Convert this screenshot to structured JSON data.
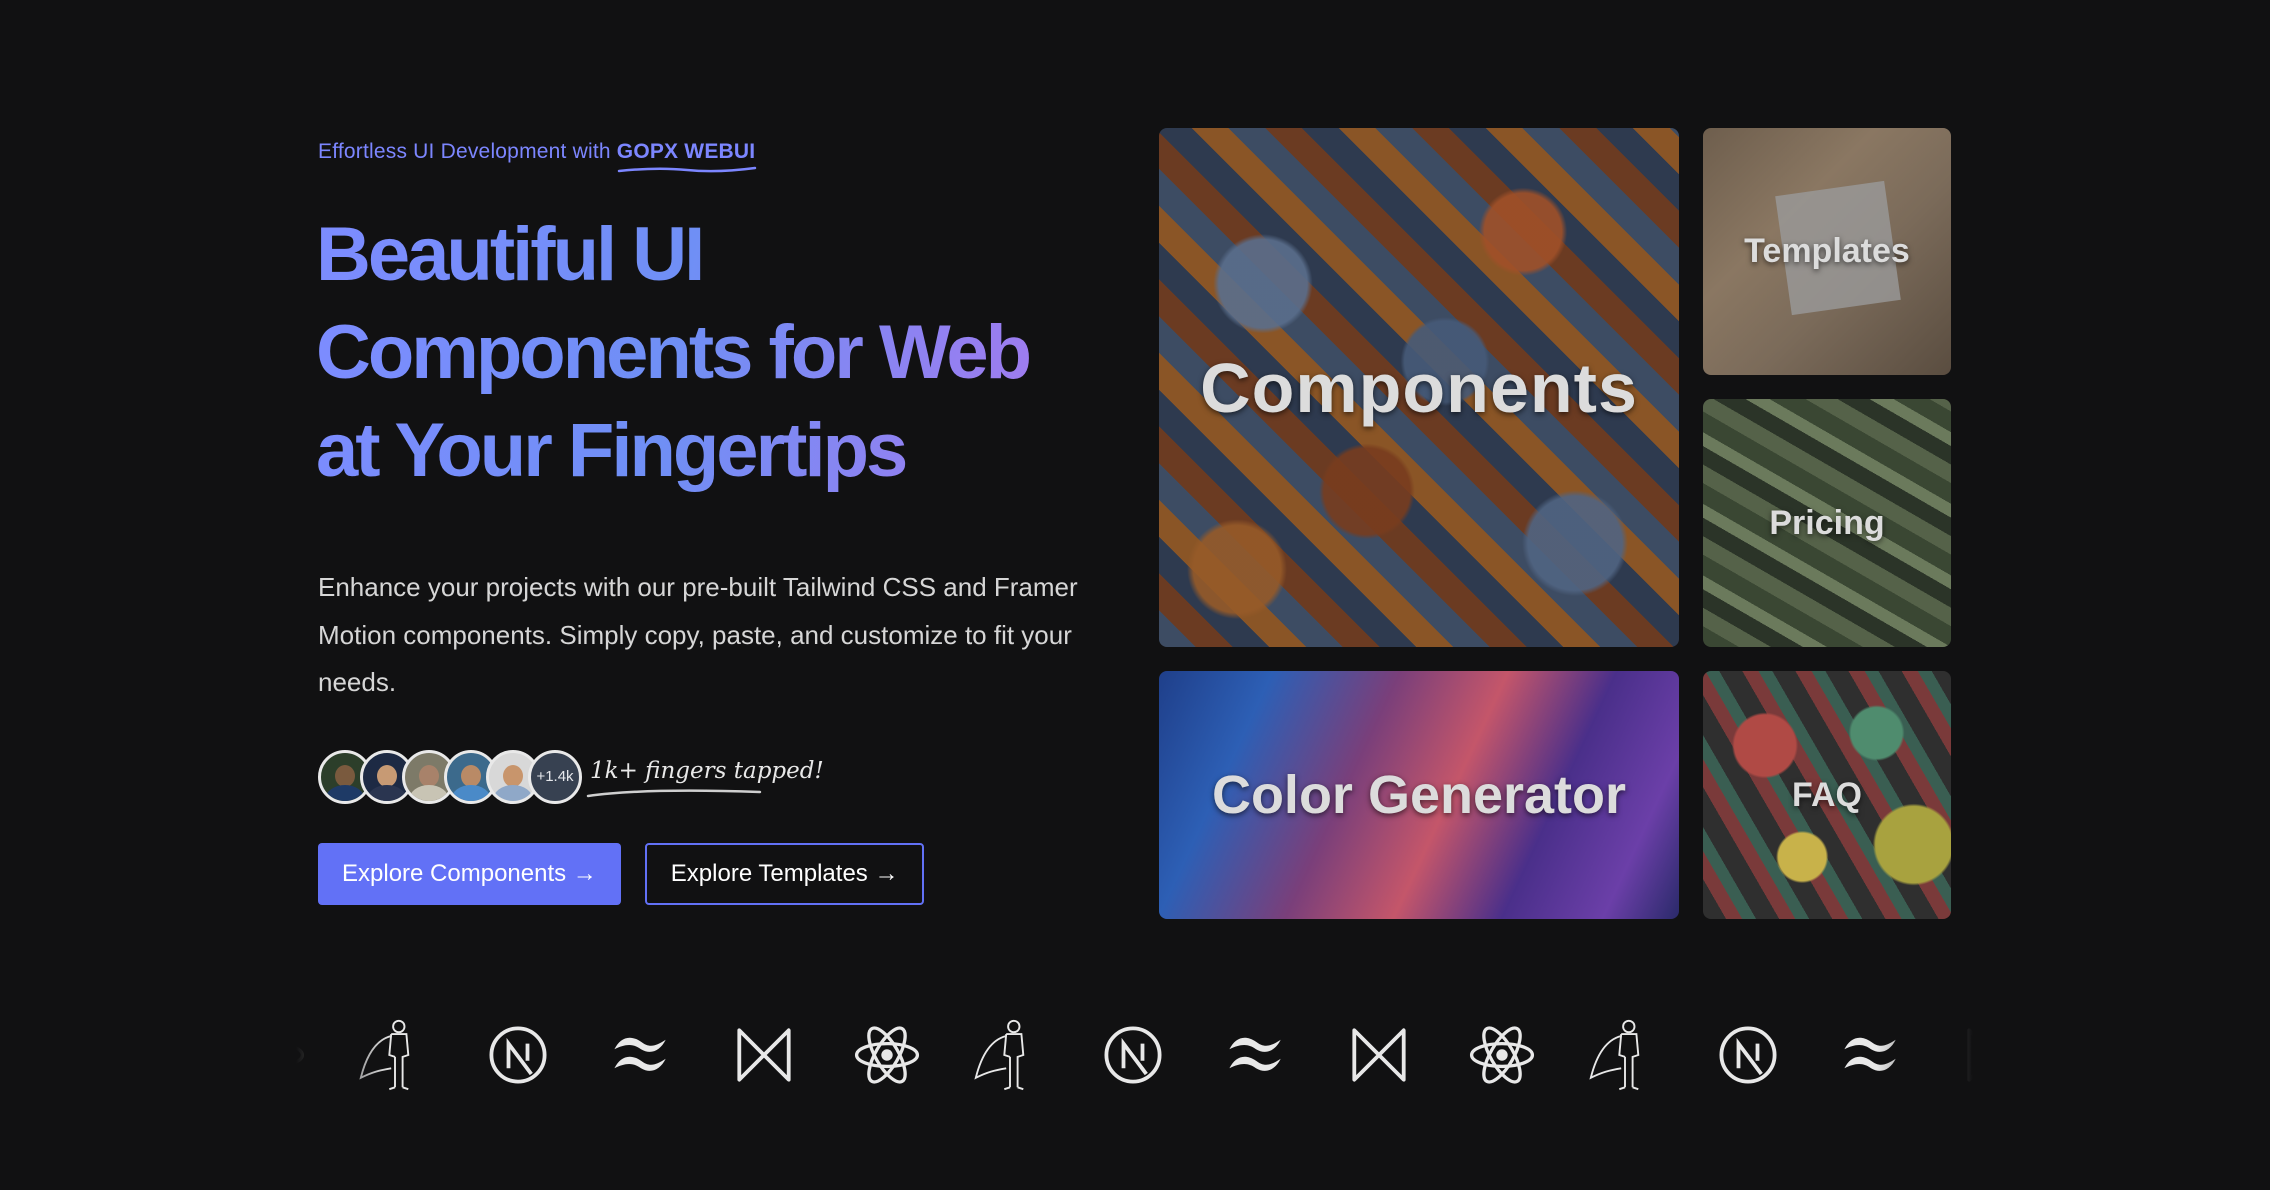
{
  "hero": {
    "eyebrow_prefix": "Effortless UI Development with",
    "eyebrow_brand": "GOPX WEBUI",
    "headline_line1": "Beautiful UI",
    "headline_line2": "Components for Web",
    "headline_line3": "at Your Fingertips",
    "description": "Enhance your projects with our pre-built Tailwind CSS and Framer Motion components. Simply copy, paste, and customize to fit your needs.",
    "avatars_more": "+1.4k",
    "tapped_text": "1k+ fingers tapped!",
    "primary_button": "Explore Components →",
    "secondary_button": "Explore Templates →"
  },
  "tiles": {
    "components": "Components",
    "templates": "Templates",
    "pricing": "Pricing",
    "color_generator": "Color Generator",
    "faq": "FAQ"
  },
  "logos": [
    "superhero-icon",
    "nextjs-icon",
    "tailwind-icon",
    "framer-motion-icon",
    "react-icon"
  ],
  "colors": {
    "background": "#111112",
    "accent": "#6271f6",
    "eyebrow": "#7c86ff"
  }
}
